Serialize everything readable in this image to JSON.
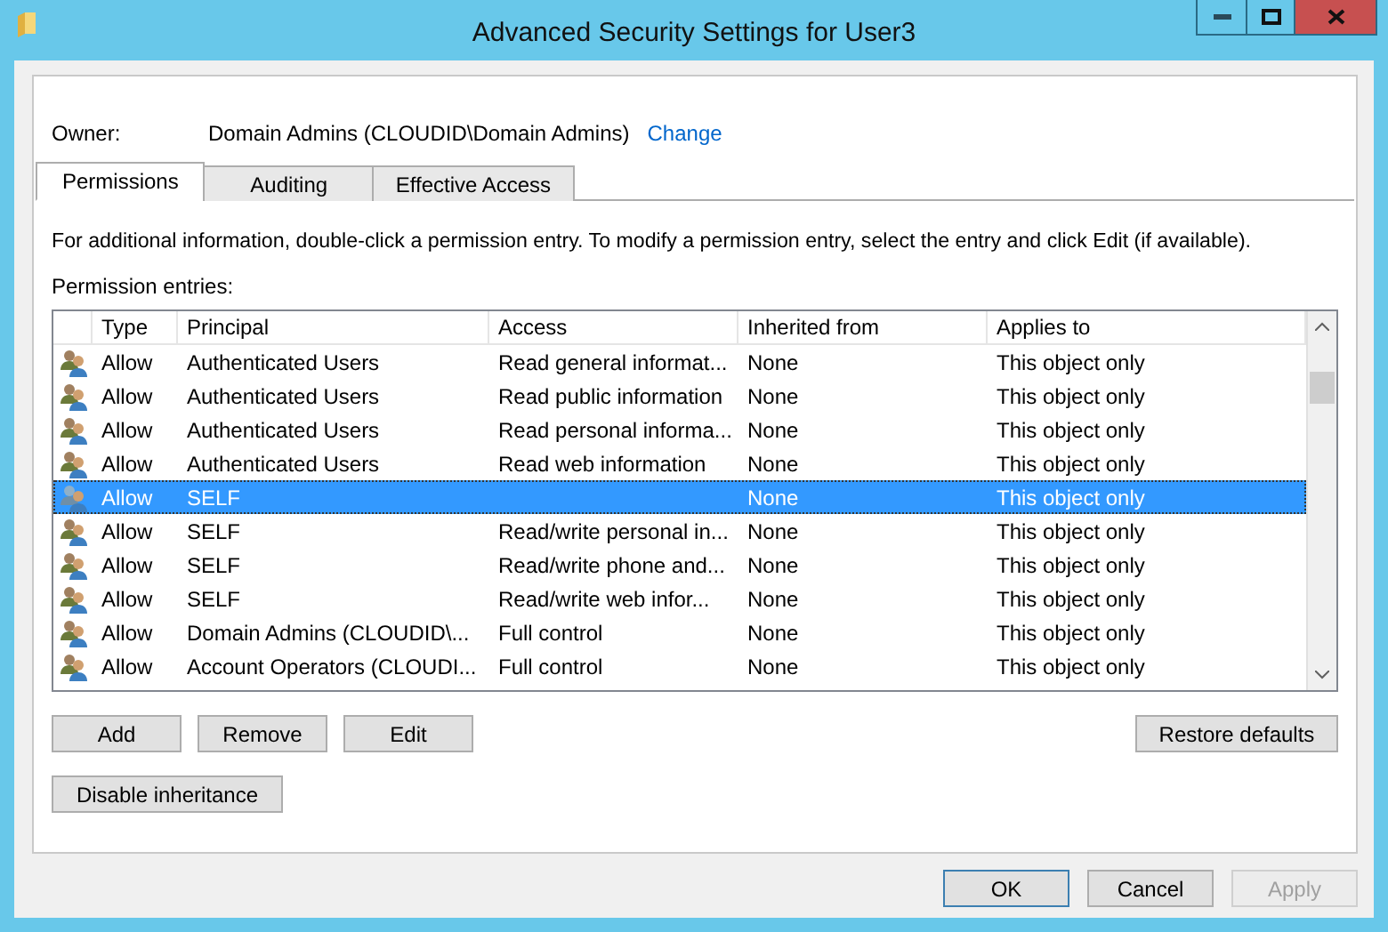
{
  "window": {
    "title": "Advanced Security Settings for User3"
  },
  "owner": {
    "label": "Owner:",
    "value": "Domain Admins (CLOUDID\\Domain Admins)",
    "link": "Change"
  },
  "tabs": [
    {
      "label": "Permissions",
      "selected": true
    },
    {
      "label": "Auditing",
      "selected": false
    },
    {
      "label": "Effective Access",
      "selected": false
    }
  ],
  "description": "For additional information, double-click a permission entry. To modify a permission entry, select the entry and click Edit (if available).",
  "entries_label": "Permission entries:",
  "table": {
    "columns": [
      "Type",
      "Principal",
      "Access",
      "Inherited from",
      "Applies to"
    ],
    "rows": [
      {
        "type": "Allow",
        "principal": "Authenticated Users",
        "access": "Read general informat...",
        "inherited_from": "None",
        "applies_to": "This object only",
        "selected": false
      },
      {
        "type": "Allow",
        "principal": "Authenticated Users",
        "access": "Read public information",
        "inherited_from": "None",
        "applies_to": "This object only",
        "selected": false
      },
      {
        "type": "Allow",
        "principal": "Authenticated Users",
        "access": "Read personal informa...",
        "inherited_from": "None",
        "applies_to": "This object only",
        "selected": false
      },
      {
        "type": "Allow",
        "principal": "Authenticated Users",
        "access": "Read web information",
        "inherited_from": "None",
        "applies_to": "This object only",
        "selected": false
      },
      {
        "type": "Allow",
        "principal": "SELF",
        "inherited_from": "None",
        "applies_to": "This object only",
        "selected": true
      },
      {
        "type": "Allow",
        "principal": "SELF",
        "access": "Read/write personal in...",
        "inherited_from": "None",
        "applies_to": "This object only",
        "selected": false
      },
      {
        "type": "Allow",
        "principal": "SELF",
        "access": "Read/write phone and...",
        "inherited_from": "None",
        "applies_to": "This object only",
        "selected": false
      },
      {
        "type": "Allow",
        "principal": "SELF",
        "access": "Read/write web infor...",
        "inherited_from": "None",
        "applies_to": "This object only",
        "selected": false
      },
      {
        "type": "Allow",
        "principal": "Domain Admins (CLOUDID\\...",
        "access": "Full control",
        "inherited_from": "None",
        "applies_to": "This object only",
        "selected": false
      },
      {
        "type": "Allow",
        "principal": "Account Operators (CLOUDI...",
        "access": "Full control",
        "inherited_from": "None",
        "applies_to": "This object only",
        "selected": false
      }
    ]
  },
  "entry_buttons": [
    "Add",
    "Remove",
    "Edit"
  ],
  "restore_button": "Restore defaults",
  "inheritance_button": "Disable inheritance",
  "dialog_buttons": [
    {
      "label": "OK",
      "default": true,
      "disabled": false
    },
    {
      "label": "Cancel",
      "default": false,
      "disabled": false
    },
    {
      "label": "Apply",
      "default": false,
      "disabled": true
    }
  ]
}
